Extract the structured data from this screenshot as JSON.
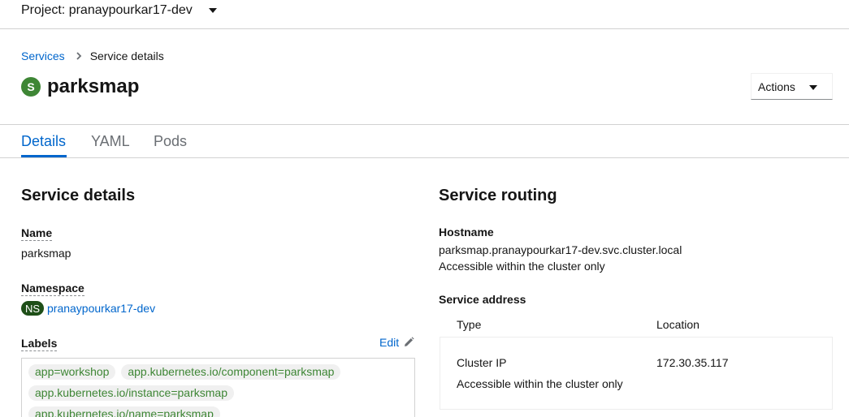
{
  "project": {
    "label": "Project: pranaypourkar17-dev"
  },
  "breadcrumb": {
    "parent": "Services",
    "current": "Service details"
  },
  "header": {
    "badge": "S",
    "title": "parksmap",
    "actions_label": "Actions"
  },
  "tabs": [
    {
      "label": "Details"
    },
    {
      "label": "YAML"
    },
    {
      "label": "Pods"
    }
  ],
  "details": {
    "section_title": "Service details",
    "name_label": "Name",
    "name_value": "parksmap",
    "namespace_label": "Namespace",
    "namespace_badge": "NS",
    "namespace_value": "pranaypourkar17-dev",
    "labels_label": "Labels",
    "edit_label": "Edit",
    "labels": [
      "app=workshop",
      "app.kubernetes.io/component=parksmap",
      "app.kubernetes.io/instance=parksmap",
      "app.kubernetes.io/name=parksmap"
    ]
  },
  "routing": {
    "section_title": "Service routing",
    "hostname_label": "Hostname",
    "hostname_value": "parksmap.pranaypourkar17-dev.svc.cluster.local",
    "hostname_note": "Accessible within the cluster only",
    "address_label": "Service address",
    "col_type": "Type",
    "col_location": "Location",
    "row_type": "Cluster IP",
    "row_location": "172.30.35.117",
    "row_note": "Accessible within the cluster only"
  },
  "colors": {
    "link": "#0066cc",
    "badge_green": "#3e8635",
    "ns_badge": "#1e4f18",
    "border": "#d2d2d2"
  },
  "icons": {
    "breadcrumb_separator": "chevron-right-icon",
    "edit": "pencil-icon",
    "dropdown": "caret-down-icon"
  }
}
